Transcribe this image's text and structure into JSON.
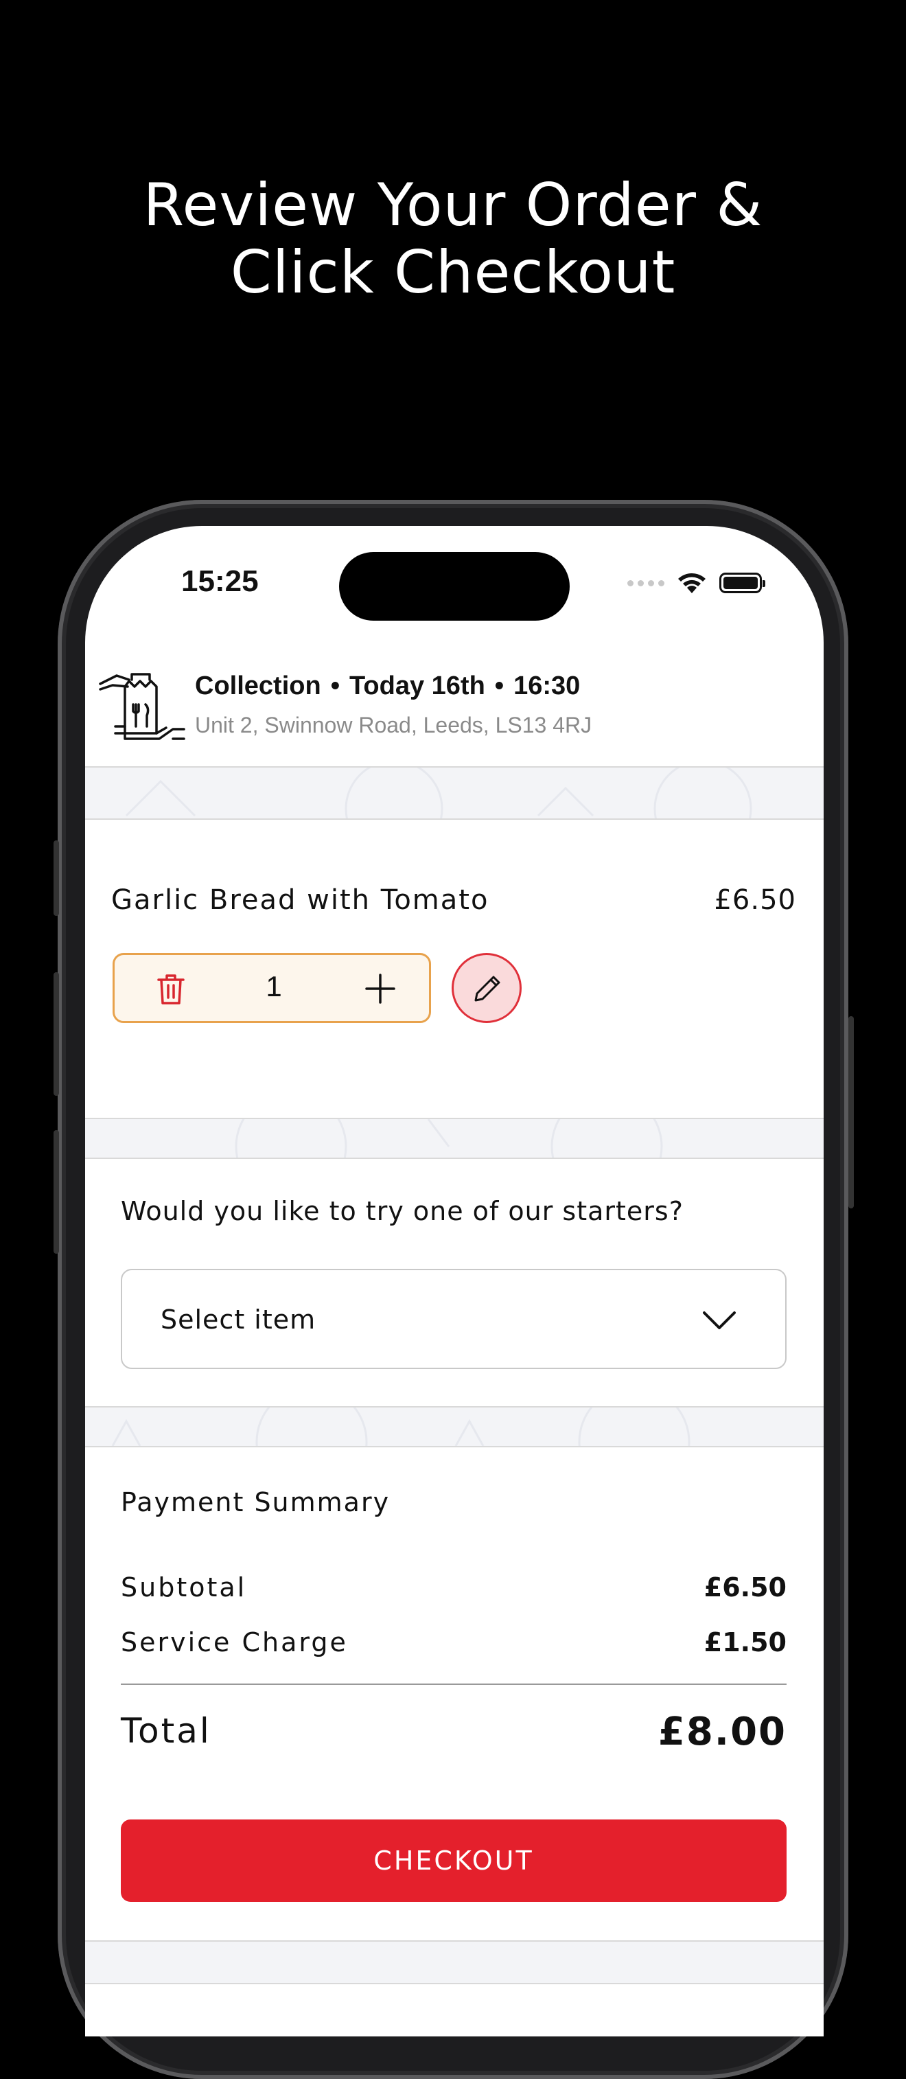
{
  "headline": {
    "line1": "Review Your Order &",
    "line2": "Click Checkout"
  },
  "status_bar": {
    "time": "15:25"
  },
  "order_header": {
    "mode": "Collection",
    "day": "Today 16th",
    "time": "16:30",
    "separator": "•",
    "address": "Unit 2,  Swinnow Road, Leeds, LS13  4RJ"
  },
  "cart": {
    "items": [
      {
        "name": "Garlic Bread with Tomato",
        "price": "£6.50",
        "quantity": "1"
      }
    ]
  },
  "upsell": {
    "question": "Would you like to try one of our starters?",
    "select_value": "Select item"
  },
  "payment": {
    "title": "Payment Summary",
    "subtotal_label": "Subtotal",
    "subtotal_value": "£6.50",
    "service_label": "Service Charge",
    "service_value": "£1.50",
    "total_label": "Total",
    "total_value": "£8.00"
  },
  "checkout_label": "CHECKOUT",
  "colors": {
    "accent_red": "#e4202c",
    "qty_border": "#e8a24c",
    "qty_bg": "#fdf6ec",
    "edit_bg": "#fadadb"
  }
}
